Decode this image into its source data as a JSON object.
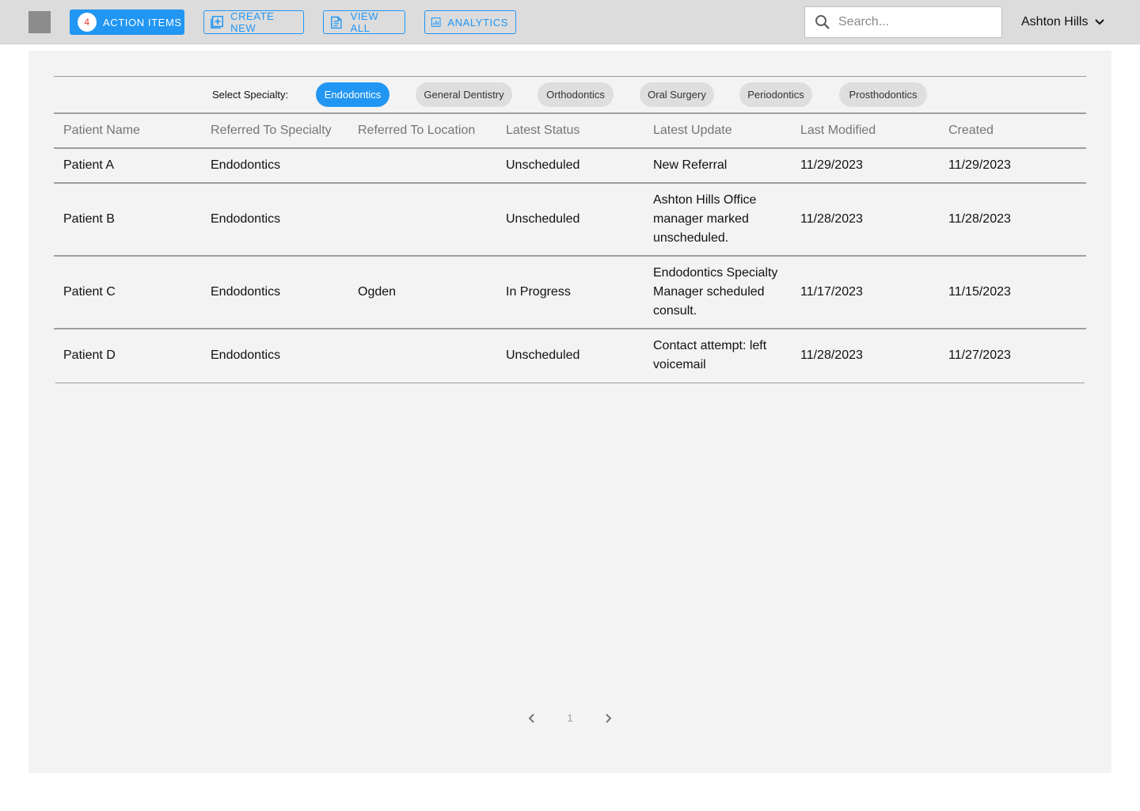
{
  "toolbar": {
    "menu_icon": "menu-square-icon",
    "action_items": {
      "count": "4",
      "label": "ACTION ITEMS"
    },
    "create_new": {
      "label": "CREATE NEW",
      "icon": "add-box-icon"
    },
    "view_all": {
      "label": "VIEW ALL",
      "icon": "document-list-icon"
    },
    "analytics": {
      "label": "ANALYTICS",
      "icon": "bar-chart-icon"
    },
    "search": {
      "placeholder": "Search...",
      "value": "",
      "icon": "search-icon"
    },
    "user": {
      "name": "Ashton Hills",
      "icon": "chevron-down-icon"
    }
  },
  "colors": {
    "accent": "#2196f3",
    "badge_text": "#e53935",
    "topbar": "#dcdcdc",
    "panel": "#f3f3f3"
  },
  "filter": {
    "label": "Select Specialty:",
    "selected": "Endodontics",
    "chips": [
      "Endodontics",
      "General Dentistry",
      "Orthodontics",
      "Oral Surgery",
      "Periodontics",
      "Prosthodontics"
    ]
  },
  "table": {
    "columns": [
      "Patient Name",
      "Referred To Specialty",
      "Referred To Location",
      "Latest Status",
      "Latest Update",
      "Last Modified",
      "Created"
    ],
    "rows": [
      [
        "Patient A",
        "Endodontics",
        "",
        "Unscheduled",
        "New Referral",
        "11/29/2023",
        "11/29/2023"
      ],
      [
        "Patient B",
        "Endodontics",
        "",
        "Unscheduled",
        "Ashton Hills Office manager marked unscheduled.",
        "11/28/2023",
        "11/28/2023"
      ],
      [
        "Patient C",
        "Endodontics",
        "Ogden",
        "In Progress",
        "Endodontics Specialty Manager scheduled consult.",
        "11/17/2023",
        "11/15/2023"
      ],
      [
        "Patient D",
        "Endodontics",
        "",
        "Unscheduled",
        "Contact attempt: left voicemail",
        "11/28/2023",
        "11/27/2023"
      ]
    ]
  },
  "pagination": {
    "current_page": "1",
    "prev_icon": "chevron-left-icon",
    "next_icon": "chevron-right-icon"
  }
}
